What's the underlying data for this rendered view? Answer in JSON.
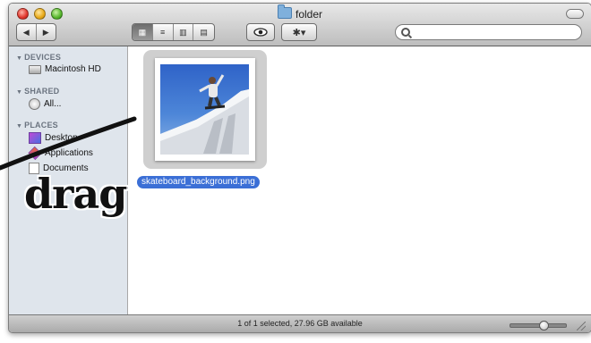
{
  "window": {
    "title": "folder"
  },
  "toolbar": {
    "nav": {
      "back_glyph": "◀",
      "forward_glyph": "▶"
    },
    "views": [
      {
        "name": "icon-view",
        "glyph": "▦",
        "active": true
      },
      {
        "name": "list-view",
        "glyph": "≡",
        "active": false
      },
      {
        "name": "column-view",
        "glyph": "▥",
        "active": false
      },
      {
        "name": "coverflow-view",
        "glyph": "▤",
        "active": false
      }
    ],
    "quicklook_icon": "eye-icon",
    "action_label": "✱▾",
    "search": {
      "value": "",
      "placeholder": ""
    }
  },
  "sidebar": {
    "devices_label": "DEVICES",
    "shared_label": "SHARED",
    "places_label": "PLACES",
    "items": {
      "macintosh_hd": "Macintosh HD",
      "all": "All...",
      "desktop": "Desktop",
      "applications": "Applications",
      "documents": "Documents"
    }
  },
  "content": {
    "file_name": "skateboard_background.png"
  },
  "statusbar": {
    "text": "1 of 1 selected, 27.96 GB available",
    "zoom_level": 0.6
  },
  "overlay": {
    "label": "drag"
  },
  "colors": {
    "selection": "#3b6fd6",
    "sidebar_bg": "#dfe5ec",
    "sky": "#2f63c8"
  }
}
